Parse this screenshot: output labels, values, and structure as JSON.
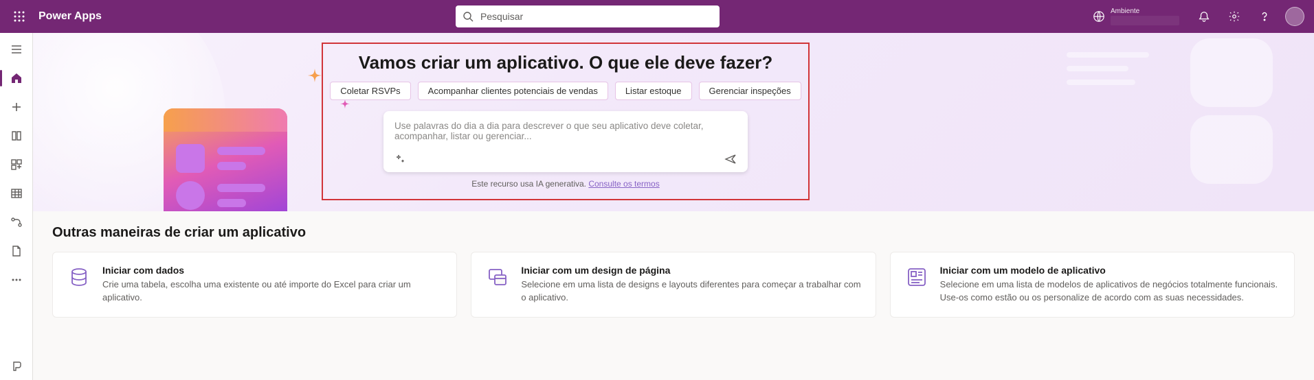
{
  "header": {
    "app_title": "Power Apps",
    "search_placeholder": "Pesquisar",
    "env_label": "Ambiente"
  },
  "hero": {
    "title": "Vamos criar um aplicativo. O que ele deve fazer?",
    "chips": [
      "Coletar RSVPs",
      "Acompanhar clientes potenciais de vendas",
      "Listar estoque",
      "Gerenciar inspeções"
    ],
    "input_placeholder": "Use palavras do dia a dia para descrever o que seu aplicativo deve coletar, acompanhar, listar ou gerenciar...",
    "footnote_text": "Este recurso usa IA generativa. ",
    "footnote_link": "Consulte os termos"
  },
  "section": {
    "title": "Outras maneiras de criar um aplicativo",
    "cards": [
      {
        "title": "Iniciar com dados",
        "desc": "Crie uma tabela, escolha uma existente ou até importe do Excel para criar um aplicativo."
      },
      {
        "title": "Iniciar com um design de página",
        "desc": "Selecione em uma lista de designs e layouts diferentes para começar a trabalhar com o aplicativo."
      },
      {
        "title": "Iniciar com um modelo de aplicativo",
        "desc": "Selecione em uma lista de modelos de aplicativos de negócios totalmente funcionais. Use-os como estão ou os personalize de acordo com as suas necessidades."
      }
    ]
  }
}
